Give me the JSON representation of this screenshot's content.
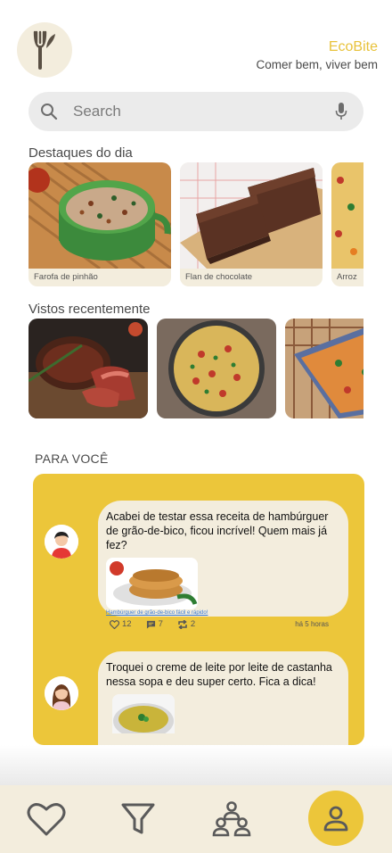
{
  "brand": {
    "name": "EcoBite",
    "tagline": "Comer bem, viver bem"
  },
  "search": {
    "placeholder": "Search"
  },
  "highlights": {
    "title": "Destaques do dia",
    "items": [
      {
        "label": "Farofa de pinhão"
      },
      {
        "label": "Flan de chocolate"
      },
      {
        "label": "Arroz"
      }
    ]
  },
  "recent": {
    "title": "Vistos recentemente"
  },
  "for_you": {
    "title": "PARA VOCÊ",
    "posts": [
      {
        "text": "Acabei de testar essa receita de hambúrguer de grão-de-bico, ficou incrível! Quem mais já fez?",
        "link_caption": "Hambúrguer de grão-de-bico fácil e rápido!",
        "likes": "12",
        "comments": "7",
        "shares": "2",
        "time": "há 5 horas"
      },
      {
        "text": "Troquei o creme de leite por leite de castanha nessa sopa e deu super certo. Fica a dica!"
      }
    ]
  },
  "colors": {
    "accent": "#ecc63a",
    "cream": "#f3eddd",
    "brand_text": "#e8c23a"
  }
}
